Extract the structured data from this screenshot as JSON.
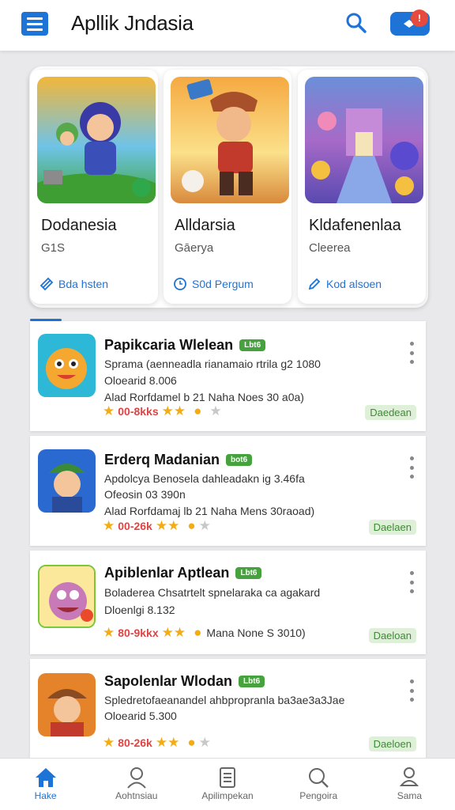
{
  "header": {
    "title": "Apllik Jndasia",
    "notification_count": "!"
  },
  "featured": [
    {
      "name": "Dodanesia",
      "subtitle": "G1S",
      "action": "Bda hsten"
    },
    {
      "name": "Alldarsia",
      "subtitle": "Gāerya",
      "action": "S0d Pergum"
    },
    {
      "name": "Kldafenenlaa",
      "subtitle": "Cleerea",
      "action": "Kod alsoen"
    }
  ],
  "apps": [
    {
      "title": "Papikcaria Wlelean",
      "badge": "Lbt6",
      "description": "Sprama (aenneadla rianamaio rtrila g2 1080",
      "size": "Oloearid 8.006",
      "extra": "Alad Rorfdamel b 21 Naha Noes 30 a0a)",
      "rating": "00-8kks",
      "status": "Daedean"
    },
    {
      "title": "Erderq Madanian",
      "badge": "bot6",
      "description": "Apdolcya Benosela dahleadakn ig 3.46fa",
      "size": "Ofeosin 03 390n",
      "extra": "Alad Rorfdamaj lb 21 Naha Mens 30raoad)",
      "rating": "00-26k",
      "status": "Daelaen"
    },
    {
      "title": "Apiblenlar Aptlean",
      "badge": "Lbt6",
      "description": "Boladerea Chsatrtelt spnelaraka ca agakard",
      "size": "Dloenlgi 8.132",
      "extra": "Mana None S 3010)",
      "rating": "80-9kkx",
      "status": "Daeloan"
    },
    {
      "title": "Sapolenlar Wlodan",
      "badge": "Lbt6",
      "description": "Spledretofaeanandel ahbpropranla ba3ae3a3Jae",
      "size": "Oloearid 5.300",
      "extra": "",
      "rating": "80-26k",
      "status": "Daeloen"
    }
  ],
  "nav": [
    {
      "label": "Hake",
      "icon": "home-icon"
    },
    {
      "label": "Aohtnsiau",
      "icon": "user-icon"
    },
    {
      "label": "Apilimpekan",
      "icon": "document-icon"
    },
    {
      "label": "Pengoira",
      "icon": "search-icon"
    },
    {
      "label": "Sama",
      "icon": "profile-icon"
    }
  ],
  "colors": {
    "accent": "#1e73d6",
    "badge_green": "#45a23d",
    "notification": "#e74a3c",
    "star": "#f3ac14"
  }
}
